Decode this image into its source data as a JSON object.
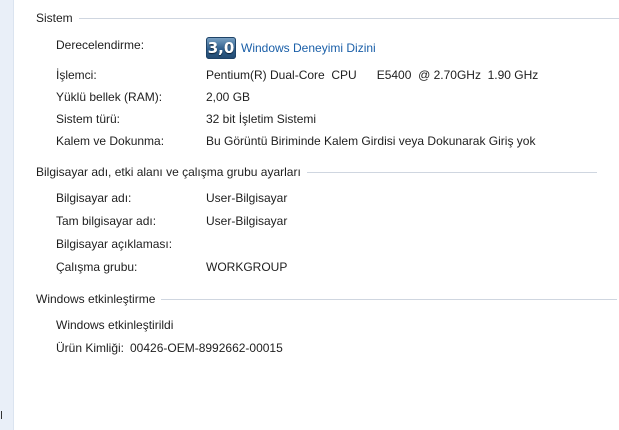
{
  "system": {
    "header": "Sistem",
    "rating": {
      "label": "Derecelendirme:",
      "score": "3,0",
      "link": "Windows Deneyimi Dizini"
    },
    "rows": [
      {
        "label": "İşlemci:",
        "value": "Pentium(R) Dual-Core  CPU      E5400  @ 2.70GHz  1.90 GHz"
      },
      {
        "label": "Yüklü bellek (RAM):",
        "value": "2,00 GB"
      },
      {
        "label": "Sistem türü:",
        "value": "32 bit İşletim Sistemi"
      },
      {
        "label": "Kalem ve Dokunma:",
        "value": "Bu Görüntü Biriminde Kalem Girdisi veya Dokunarak Giriş yok"
      }
    ]
  },
  "computer": {
    "header": "Bilgisayar adı, etki alanı ve çalışma grubu ayarları",
    "rows": [
      {
        "label": "Bilgisayar adı:",
        "value": "User-Bilgisayar"
      },
      {
        "label": "Tam bilgisayar adı:",
        "value": "User-Bilgisayar"
      },
      {
        "label": "Bilgisayar açıklaması:",
        "value": ""
      },
      {
        "label": "Çalışma grubu:",
        "value": "WORKGROUP"
      }
    ]
  },
  "activation": {
    "header": "Windows etkinleştirme",
    "status": "Windows etkinleştirildi",
    "product_id_label": "Ürün Kimliği:",
    "product_id_value": "00426-OEM-8992662-00015"
  },
  "colors": {
    "link": "#1a5fa8",
    "rule": "#cfd6e0",
    "left_strip": "#e9eff8"
  }
}
